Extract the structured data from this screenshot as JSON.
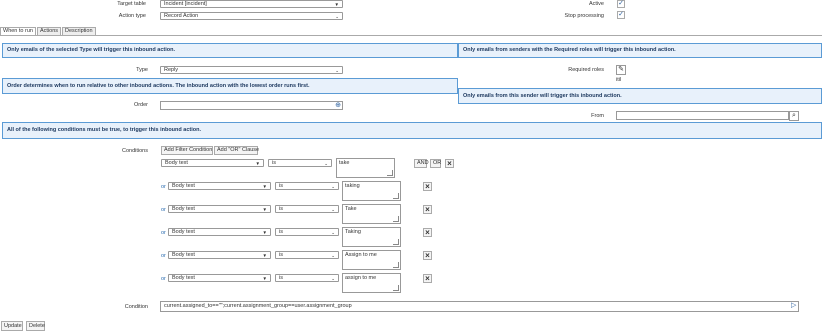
{
  "header": {
    "target_table_label": "Target table",
    "target_table_value": "Incident [incident]",
    "action_type_label": "Action type",
    "action_type_value": "Record Action",
    "active_label": "Active",
    "stop_processing_label": "Stop processing"
  },
  "tabs": [
    "When to run",
    "Actions",
    "Description"
  ],
  "messages": {
    "only_type": "Only emails of the selected Type will trigger this inbound action.",
    "only_senders_roles": "Only emails from senders with the Required roles will trigger this inbound action.",
    "order_info": "Order determines when to run relative to other inbound actions. The inbound action with the lowest order runs first.",
    "only_sender": "Only emails from this sender will trigger this inbound action.",
    "all_conditions": "All of the following conditions must be true, to trigger this inbound action."
  },
  "fields": {
    "type_label": "Type",
    "type_value": "Reply",
    "required_roles_label": "Required roles",
    "required_roles_value": "itil",
    "order_label": "Order",
    "from_label": "From",
    "conditions_label": "Conditions",
    "condition_label": "Condition",
    "condition_value": "current.assigned_to==\"\";current.assignment_group==user.assignment_group"
  },
  "condition_builder": {
    "add_filter_label": "Add Filter Condition",
    "add_or_label": "Add \"OR\" Clause",
    "and_label": "AND",
    "or_label": "OR",
    "or_text": "or",
    "rows": [
      {
        "field": "Body text",
        "operator": "is",
        "value": "take"
      },
      {
        "field": "Body text",
        "operator": "is",
        "value": "taking"
      },
      {
        "field": "Body text",
        "operator": "is",
        "value": "Take"
      },
      {
        "field": "Body text",
        "operator": "is",
        "value": "Taking"
      },
      {
        "field": "Body text",
        "operator": "is",
        "value": "Assign to me"
      },
      {
        "field": "Body text",
        "operator": "is",
        "value": "assign to me"
      }
    ]
  },
  "footer": {
    "update_label": "Update",
    "delete_label": "Delete"
  },
  "icons": {
    "check": "check-icon",
    "close": "close-icon",
    "pencil": "pencil-icon",
    "search": "search-icon",
    "caret": "caret-down-icon"
  },
  "colors": {
    "info_bg": "#e8f1fb",
    "info_border": "#5b9bd5",
    "link": "#2b6cb0"
  }
}
